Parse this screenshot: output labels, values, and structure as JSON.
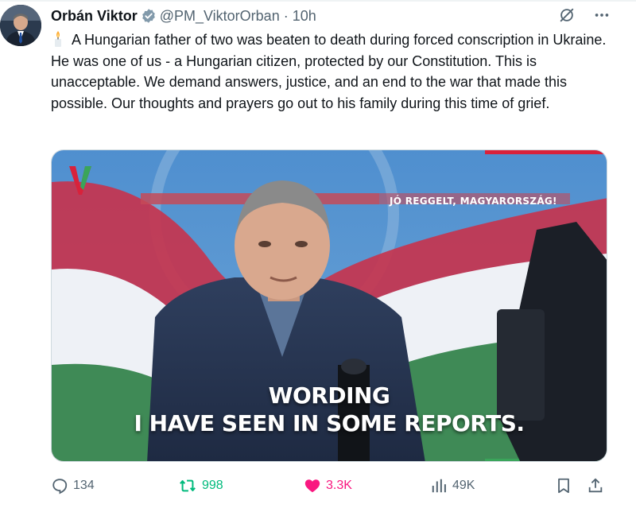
{
  "author": {
    "name": "Orbán Viktor",
    "handle": "@PM_ViktorOrban",
    "separator": "·",
    "time": "10h",
    "verified": true
  },
  "tweet": {
    "emoji": "candle",
    "text": "A Hungarian father of two was beaten to death during forced conscription in Ukraine. He was one of us - a Hungarian citizen, protected by our Constitution. This is unacceptable. We demand answers, justice, and an end to the war that made this possible. Our thoughts and prayers go out to his family during this time of grief."
  },
  "media": {
    "banner": "JÓ REGGELT, MAGYARORSZÁG!",
    "caption_line1": "WORDING",
    "caption_line2": "I HAVE SEEN IN SOME REPORTS."
  },
  "stats": {
    "replies": "134",
    "reposts": "998",
    "likes": "3.3K",
    "views": "49K"
  },
  "colors": {
    "repost_active": "#00ba7c",
    "like_active": "#f91880",
    "verified_badge": "#829aab",
    "text_secondary": "#536471"
  }
}
